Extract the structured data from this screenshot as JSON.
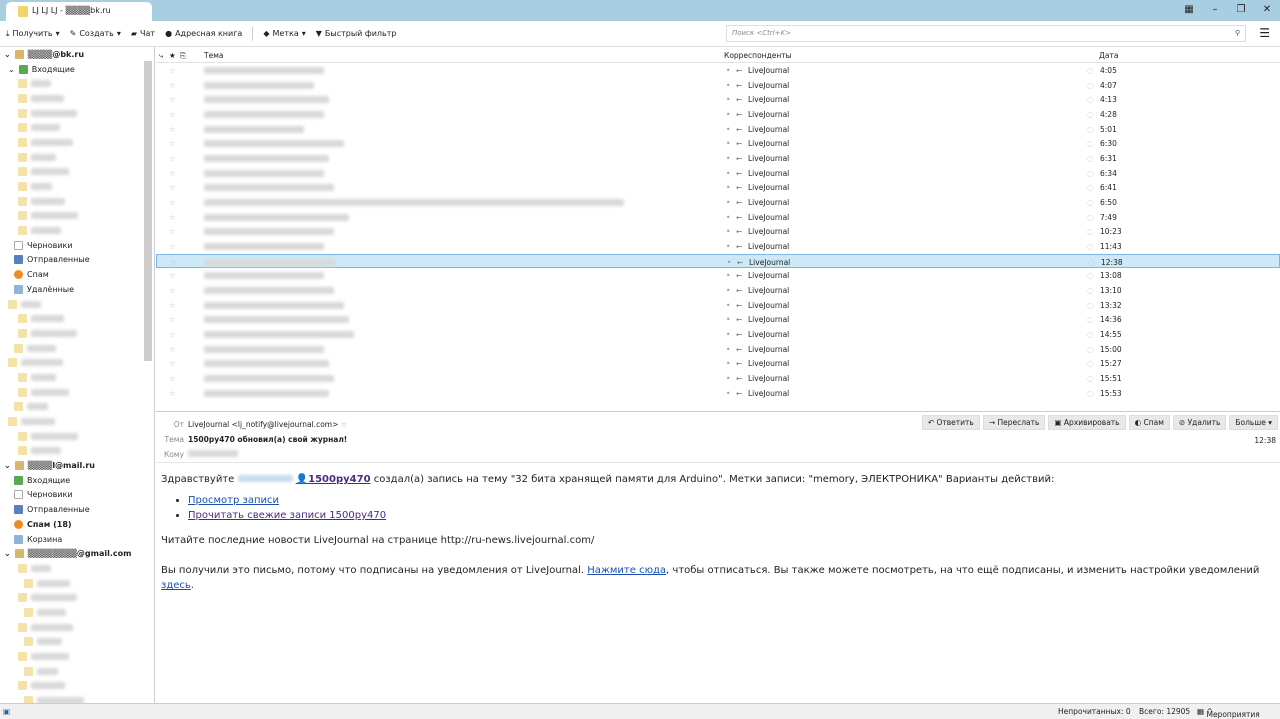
{
  "window": {
    "tab_title": "LJ LJ LJ - ▒▒▒▒bk.ru"
  },
  "toolbar": {
    "get": "Получить",
    "create": "Создать",
    "chat": "Чат",
    "addressbook": "Адресная книга",
    "tag": "Метка",
    "filter": "Быстрый фильтр",
    "search_placeholder": "Поиск <Ctrl+K>"
  },
  "folders": {
    "acc1": "▒▒▒▒@bk.ru",
    "acc1_inbox": "Входящие",
    "drafts": "Черновики",
    "sent": "Отправленные",
    "spam": "Спам",
    "deleted": "Удалённые",
    "acc2": "▒▒▒▒l@mail.ru",
    "acc2_inbox": "Входящие",
    "acc2_drafts": "Черновики",
    "acc2_sent": "Отправленные",
    "acc2_spam": "Спам (18)",
    "acc2_trash": "Корзина",
    "acc3": "▒▒▒▒▒▒▒▒@gmail.com"
  },
  "list": {
    "col_subject": "Тема",
    "col_from": "Корреспонденты",
    "col_date": "Дата",
    "rows": [
      {
        "from": "LiveJournal",
        "date": "4:05"
      },
      {
        "from": "LiveJournal",
        "date": "4:07"
      },
      {
        "from": "LiveJournal",
        "date": "4:13"
      },
      {
        "from": "LiveJournal",
        "date": "4:28"
      },
      {
        "from": "LiveJournal",
        "date": "5:01"
      },
      {
        "from": "LiveJournal",
        "date": "6:30"
      },
      {
        "from": "LiveJournal",
        "date": "6:31"
      },
      {
        "from": "LiveJournal",
        "date": "6:34"
      },
      {
        "from": "LiveJournal",
        "date": "6:41"
      },
      {
        "from": "LiveJournal",
        "date": "6:50"
      },
      {
        "from": "LiveJournal",
        "date": "7:49"
      },
      {
        "from": "LiveJournal",
        "date": "10:23"
      },
      {
        "from": "LiveJournal",
        "date": "11:43"
      },
      {
        "from": "LiveJournal",
        "date": "12:38",
        "selected": true
      },
      {
        "from": "LiveJournal",
        "date": "13:08"
      },
      {
        "from": "LiveJournal",
        "date": "13:10"
      },
      {
        "from": "LiveJournal",
        "date": "13:32"
      },
      {
        "from": "LiveJournal",
        "date": "14:36"
      },
      {
        "from": "LiveJournal",
        "date": "14:55"
      },
      {
        "from": "LiveJournal",
        "date": "15:00"
      },
      {
        "from": "LiveJournal",
        "date": "15:27"
      },
      {
        "from": "LiveJournal",
        "date": "15:51"
      },
      {
        "from": "LiveJournal",
        "date": "15:53"
      }
    ]
  },
  "message": {
    "from_label": "От",
    "from": "LiveJournal <lj_notify@livejournal.com>",
    "subject_label": "Тема",
    "subject": "1500py470 обновил(а) свой журнал!",
    "to_label": "Кому",
    "time": "12:38",
    "actions": {
      "reply": "Ответить",
      "forward": "Переслать",
      "archive": "Архивировать",
      "spam": "Спам",
      "delete": "Удалить",
      "more": "Больше"
    },
    "greeting": "Здравствуйте",
    "user": "1500py470",
    "text1": "создал(а) запись на тему \"32 бита хранящей памяти для Arduino\". Метки записи: \"memory, ЭЛЕКТРОНИКА\" Варианты действий:",
    "link1": "Просмотр записи",
    "link2": "Прочитать свежие записи 1500py470",
    "news": "Читайте последние новости LiveJournal на странице http://ru-news.livejournal.com/",
    "footer1": "Вы получили это письмо, потому что подписаны на уведомления от LiveJournal.",
    "footer_link1": "Нажмите сюда",
    "footer2": ", чтобы отписаться. Вы также можете посмотреть, на что ещё подписаны, и изменить настройки уведомлений",
    "footer_link2": "здесь",
    "footer3": "."
  },
  "status": {
    "unread": "Непрочитанных: 0",
    "total": "Всего: 12905",
    "events": "Мероприятия"
  }
}
